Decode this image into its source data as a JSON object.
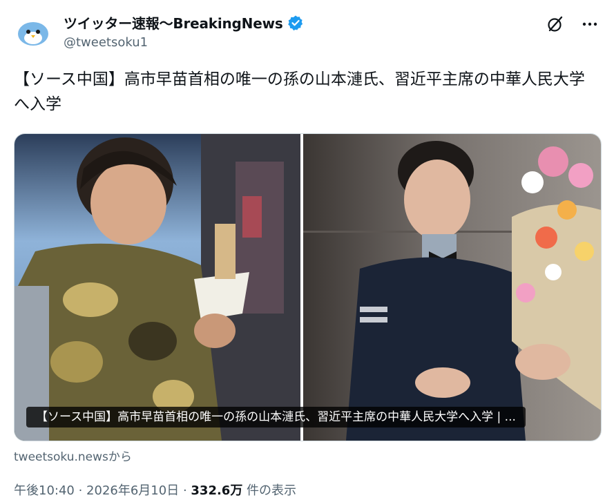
{
  "author": {
    "display_name": "ツイッター速報〜BreakingNews",
    "handle": "@tweetsoku1",
    "verified_color": "#1d9bf0"
  },
  "header_icons": [
    "grok-icon",
    "more-icon"
  ],
  "tweet": {
    "text": "【ソース中国】高市早苗首相の唯一の孫の山本漣氏、習近平主席の中華人民大学へ入学"
  },
  "card": {
    "caption": "【ソース中国】高市早苗首相の唯一の孫の山本漣氏、習近平主席の中華人民大学へ入学 | ...",
    "source": "tweetsoku.newsから"
  },
  "meta": {
    "time": "午後10:40",
    "sep1": " · ",
    "date": "2026年6月10日",
    "sep2": " · ",
    "views": "332.6万",
    "views_label": " 件の表示"
  }
}
